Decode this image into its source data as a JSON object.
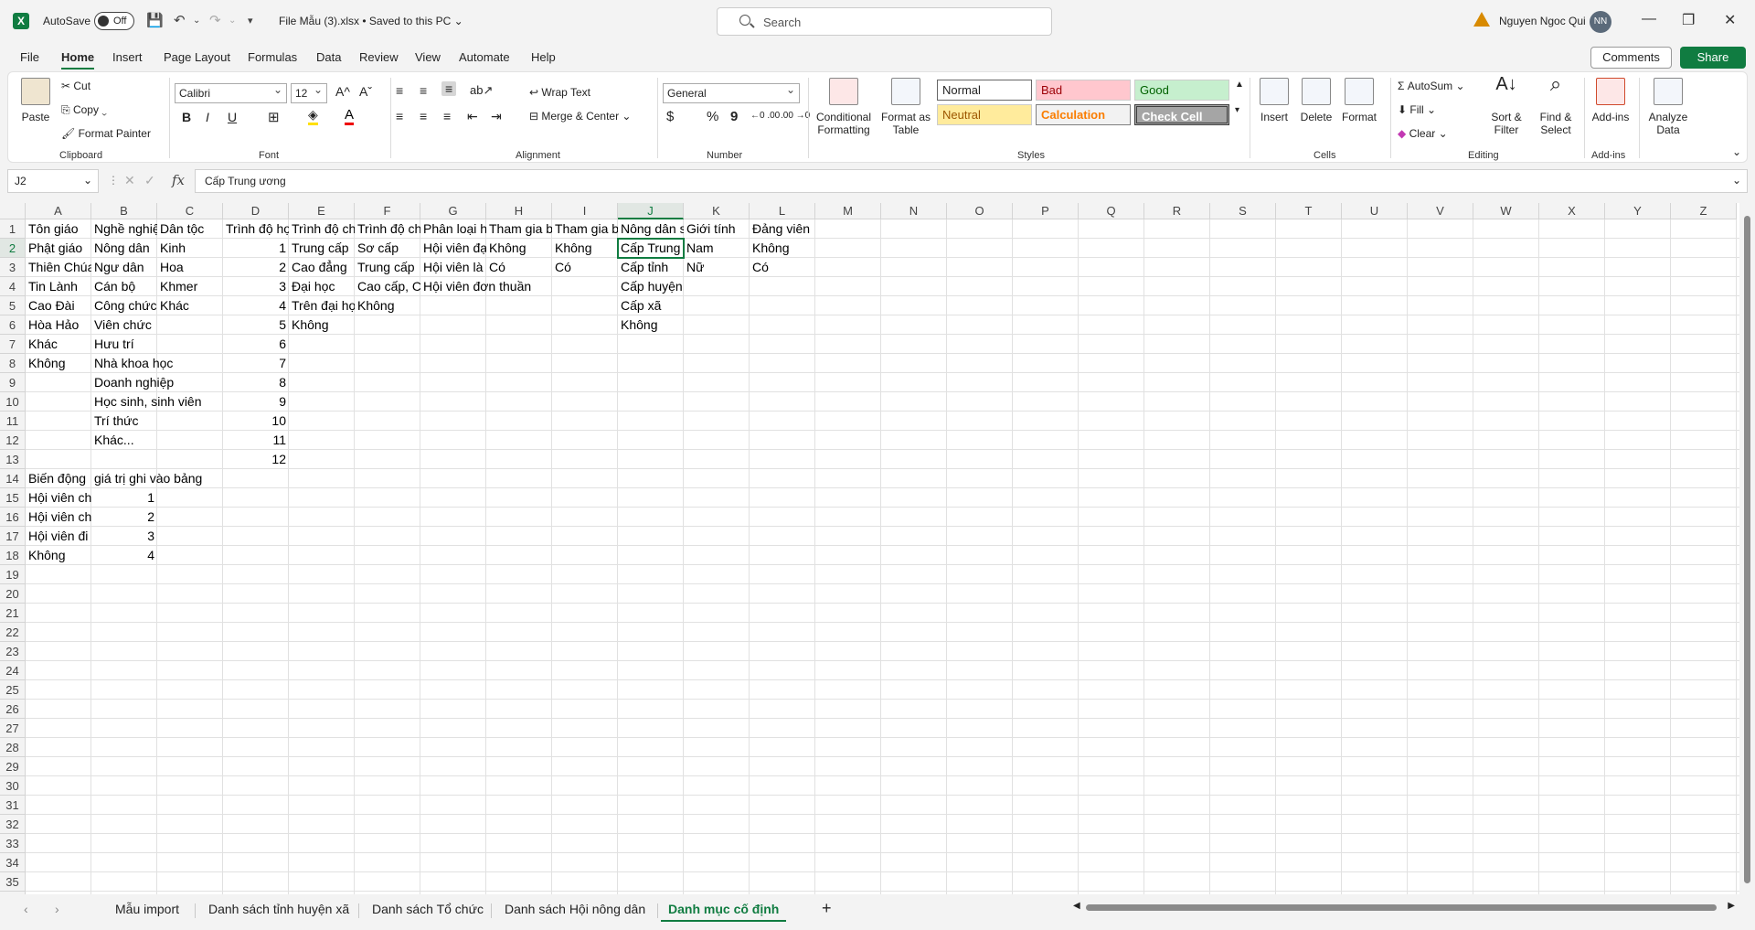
{
  "window": {
    "autosave_label": "AutoSave",
    "autosave_state": "Off",
    "filename": "File Mẫu (3).xlsx",
    "save_status": "•  Saved to this PC ⌄",
    "search_placeholder": "Search",
    "username": "Nguyen Ngoc Qui",
    "avatar_initials": "NN",
    "minimize": "—",
    "restore": "❐",
    "close": "✕"
  },
  "menu": {
    "file": "File",
    "home": "Home",
    "insert": "Insert",
    "page_layout": "Page Layout",
    "formulas": "Formulas",
    "data": "Data",
    "review": "Review",
    "view": "View",
    "automate": "Automate",
    "help": "Help",
    "comments": "Comments",
    "share": "Share"
  },
  "ribbon": {
    "clipboard": {
      "paste": "Paste",
      "cut": "Cut",
      "copy": "Copy",
      "format_painter": "Format Painter",
      "label": "Clipboard"
    },
    "font": {
      "name": "Calibri",
      "size": "12",
      "bold": "B",
      "italic": "I",
      "underline": "U",
      "label": "Font"
    },
    "alignment": {
      "wrap_text": "Wrap Text",
      "merge_center": "Merge & Center",
      "label": "Alignment"
    },
    "number": {
      "format": "General",
      "currency": "$",
      "percent": "%",
      "comma": "9",
      "label": "Number"
    },
    "styles": {
      "conditional": "Conditional\nFormatting",
      "format_table": "Format as\nTable",
      "normal": "Normal",
      "bad": "Bad",
      "good": "Good",
      "neutral": "Neutral",
      "calculation": "Calculation",
      "check_cell": "Check Cell",
      "label": "Styles"
    },
    "cells": {
      "insert": "Insert",
      "delete": "Delete",
      "format": "Format",
      "label": "Cells"
    },
    "editing": {
      "autosum": "AutoSum",
      "fill": "Fill",
      "clear": "Clear",
      "sort_filter": "Sort &\nFilter",
      "find_select": "Find &\nSelect",
      "label": "Editing"
    },
    "addins": {
      "addins": "Add-ins",
      "label": "Add-ins"
    },
    "analyze": {
      "analyze": "Analyze\nData"
    }
  },
  "formula_bar": {
    "name_box": "J2",
    "fx": "fx",
    "formula": "Cấp Trung ương"
  },
  "columns": [
    "A",
    "B",
    "C",
    "D",
    "E",
    "F",
    "G",
    "H",
    "I",
    "J",
    "K",
    "L",
    "M",
    "N",
    "O",
    "P",
    "Q",
    "R",
    "S",
    "T",
    "U",
    "V",
    "W",
    "X",
    "Y",
    "Z"
  ],
  "rows": [
    "1",
    "2",
    "3",
    "4",
    "5",
    "6",
    "7",
    "8",
    "9",
    "10",
    "11",
    "12",
    "13",
    "14",
    "15",
    "16",
    "17",
    "18",
    "19",
    "20",
    "21",
    "22",
    "23",
    "24",
    "25",
    "26",
    "27",
    "28",
    "29",
    "30",
    "31",
    "32",
    "33",
    "34",
    "35",
    "36"
  ],
  "cells": {
    "A1": "Tôn giáo",
    "B1": "Nghề nghiệ",
    "C1": "Dân tộc",
    "D1": "Trình độ họ",
    "E1": "Trình độ ch",
    "F1": "Trình độ ch",
    "G1": "Phân loại h",
    "H1": "Tham gia b",
    "I1": "Tham gia b",
    "J1": "Nông dân s",
    "K1": "Giới tính",
    "L1": "Đảng viên",
    "A2": "Phật giáo",
    "B2": "Nông dân",
    "C2": "Kinh",
    "D2": "1",
    "E2": "Trung cấp",
    "F2": "Sơ cấp",
    "G2": "Hội viên đạ",
    "H2": "Không",
    "I2": "Không",
    "J2": "Cấp Trung",
    "K2": "Nam",
    "L2": "Không",
    "A3": "Thiên Chúa",
    "B3": "Ngư dân",
    "C3": "Hoa",
    "D3": "2",
    "E3": "Cao đẳng",
    "F3": "Trung cấp",
    "G3": "Hội viên là",
    "H3": "Có",
    "I3": "Có",
    "J3": "Cấp tỉnh",
    "K3": "Nữ",
    "L3": "Có",
    "A4": "Tin Lành",
    "B4": "Cán bộ",
    "C4": "Khmer",
    "D4": "3",
    "E4": "Đại học",
    "F4": "Cao cấp, C",
    "G4": "Hội viên đơn thuần",
    "J4": "Cấp huyện",
    "A5": "Cao Đài",
    "B5": "Công chức",
    "C5": "Khác",
    "D5": "4",
    "E5": "Trên đại họ",
    "F5": "Không",
    "J5": "Cấp xã",
    "A6": "Hòa Hảo",
    "B6": "Viên chức",
    "D6": "5",
    "E6": "Không",
    "J6": "Không",
    "A7": "Khác",
    "B7": "Hưu trí",
    "D7": "6",
    "A8": "Không",
    "B8": "Nhà khoa học",
    "D8": "7",
    "B9": "Doanh nghiệp",
    "D9": "8",
    "B10": "Học sinh, sinh viên",
    "D10": "9",
    "B11": "Trí thức",
    "D11": "10",
    "B12": "Khác...",
    "D12": "11",
    "D13": "12",
    "A14": "Biến động",
    "B14": "giá trị ghi vào bảng",
    "A15": "Hội viên ch",
    "B15": "1",
    "A16": "Hội viên ch",
    "B16": "2",
    "A17": "Hội viên đi",
    "B17": "3",
    "A18": "Không",
    "B18": "4"
  },
  "sheets": [
    "Mẫu import",
    "Danh sách tỉnh huyện xã",
    "Danh sách Tổ chức",
    "Danh sách Hội nông dân",
    "Danh mục cố định"
  ],
  "active_sheet": "Danh mục cố định",
  "colors": {
    "accent": "#107c41",
    "bad_bg": "#ffc7ce",
    "bad_fg": "#9c0006",
    "good_bg": "#c6efce",
    "good_fg": "#006100",
    "neutral_bg": "#ffeb9c",
    "neutral_fg": "#9c5700",
    "calc_fg": "#fa7d00",
    "check_bg": "#a5a5a5"
  }
}
